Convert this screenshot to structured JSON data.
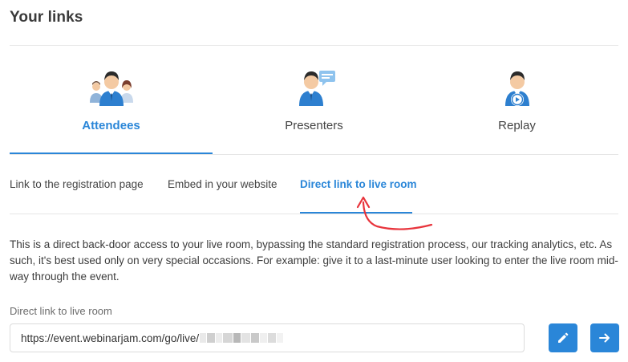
{
  "header": {
    "title": "Your links"
  },
  "roles": [
    {
      "label": "Attendees",
      "icon": "attendees-group-icon",
      "active": true
    },
    {
      "label": "Presenters",
      "icon": "presenter-chat-icon",
      "active": false
    },
    {
      "label": "Replay",
      "icon": "replay-video-icon",
      "active": false
    }
  ],
  "subtabs": [
    {
      "label": "Link to the registration page",
      "active": false
    },
    {
      "label": "Embed in your website",
      "active": false
    },
    {
      "label": "Direct link to live room",
      "active": true
    }
  ],
  "description": "This is a direct back-door access to your live room, bypassing the standard registration process, our tracking analytics, etc. As such, it's best used only on very special occasions. For example: give it to a last-minute user looking to enter the live room mid-way through the event.",
  "link_field": {
    "label": "Direct link to live room",
    "value": "https://event.webinarjam.com/go/live/"
  },
  "actions": {
    "edit_icon": "pencil-icon",
    "go_icon": "arrow-right-icon"
  },
  "colors": {
    "accent": "#2a86d8",
    "annotation": "#e8343c"
  }
}
